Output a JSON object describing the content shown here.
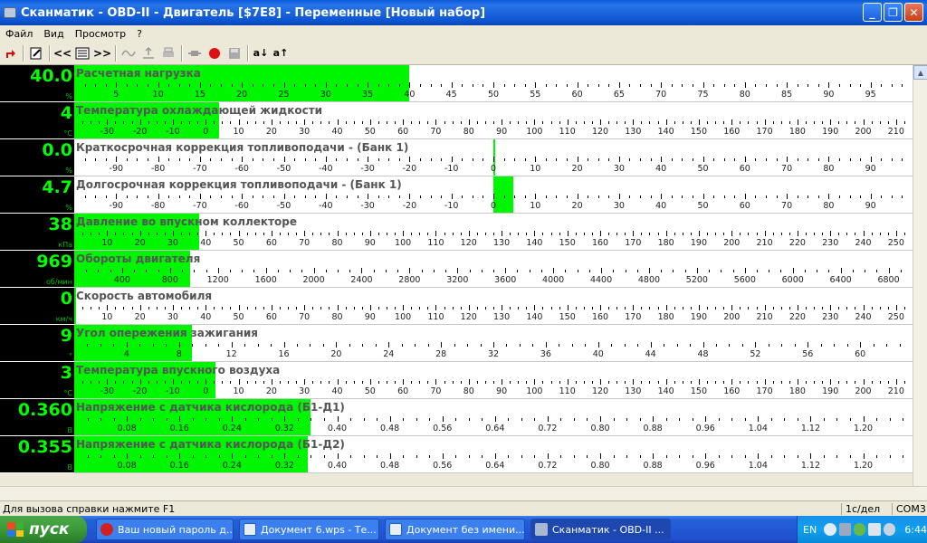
{
  "window": {
    "title": "Сканматик - OBD-II - Двигатель [$7E8] - Переменные [Новый набор]",
    "buttons": [
      "_",
      "❐",
      "✕"
    ]
  },
  "menu": [
    "Файл",
    "Вид",
    "Просмотр",
    "?"
  ],
  "toolbar": {
    "icons": [
      "exit-icon",
      "edit-icon",
      "prev-icon",
      "list-icon",
      "next-icon",
      "wave-icon",
      "upload-icon",
      "print-icon",
      "connector-icon",
      "record-icon",
      "save-icon",
      "sort-asc-icon",
      "sort-desc-icon"
    ],
    "glyphs": {
      "prev": "<<",
      "next": ">>",
      "sort_asc": "a↓",
      "sort_desc": "a↑"
    }
  },
  "parameters": [
    {
      "title": "Расчетная нагрузка",
      "value": "40.0",
      "unit": "%",
      "bar": [
        0,
        40
      ],
      "axis": {
        "min": 0,
        "max": 100,
        "major": 5,
        "labels": [
          "5",
          "10",
          "15",
          "20",
          "25",
          "30",
          "35",
          "40",
          "45",
          "50",
          "55",
          "60",
          "65",
          "70",
          "75",
          "80",
          "85",
          "90",
          "95"
        ]
      }
    },
    {
      "title": "Температура охлаждающей жидкости",
      "value": "4",
      "unit": "°C",
      "bar": [
        -40,
        4
      ],
      "axis": {
        "min": -40,
        "max": 215,
        "major": 10,
        "labels": [
          "-30",
          "-20",
          "-10",
          "0",
          "10",
          "20",
          "30",
          "40",
          "50",
          "60",
          "70",
          "80",
          "90",
          "100",
          "110",
          "120",
          "130",
          "140",
          "150",
          "160",
          "170",
          "180",
          "190",
          "200",
          "210"
        ]
      }
    },
    {
      "title": "Краткосрочная коррекция топливоподачи - (Банк 1)",
      "value": "0.0",
      "unit": "%",
      "bar": [
        0,
        0
      ],
      "axis": {
        "min": -100,
        "max": 100,
        "major": 10,
        "labels": [
          "-90",
          "-80",
          "-70",
          "-60",
          "-50",
          "-40",
          "-30",
          "-20",
          "-10",
          "0",
          "10",
          "20",
          "30",
          "40",
          "50",
          "60",
          "70",
          "80",
          "90"
        ]
      }
    },
    {
      "title": "Долгосрочная коррекция топливоподачи -  (Банк 1)",
      "value": "4.7",
      "unit": "%",
      "bar": [
        0,
        4.7
      ],
      "axis": {
        "min": -100,
        "max": 100,
        "major": 10,
        "labels": [
          "-90",
          "-80",
          "-70",
          "-60",
          "-50",
          "-40",
          "-30",
          "-20",
          "-10",
          "0",
          "10",
          "20",
          "30",
          "40",
          "50",
          "60",
          "70",
          "80",
          "90"
        ]
      }
    },
    {
      "title": "Давление во впускном коллекторе",
      "value": "38",
      "unit": "кПа",
      "bar": [
        0,
        38
      ],
      "axis": {
        "min": 0,
        "max": 255,
        "major": 10,
        "labels": [
          "10",
          "20",
          "30",
          "40",
          "50",
          "60",
          "70",
          "80",
          "90",
          "100",
          "110",
          "120",
          "130",
          "140",
          "150",
          "160",
          "170",
          "180",
          "190",
          "200",
          "210",
          "220",
          "230",
          "240",
          "250"
        ]
      }
    },
    {
      "title": "Обороты двигателя",
      "value": "969",
      "unit": "об/мин",
      "bar": [
        0,
        969
      ],
      "axis": {
        "min": 0,
        "max": 7000,
        "major": 400,
        "labels": [
          "400",
          "800",
          "1200",
          "1600",
          "2000",
          "2400",
          "2800",
          "3200",
          "3600",
          "4000",
          "4400",
          "4800",
          "5200",
          "5600",
          "6000",
          "6400",
          "6800"
        ]
      }
    },
    {
      "title": "Скорость автомобиля",
      "value": "0",
      "unit": "км/ч",
      "bar": [
        0,
        0
      ],
      "axis": {
        "min": 0,
        "max": 255,
        "major": 10,
        "labels": [
          "10",
          "20",
          "30",
          "40",
          "50",
          "60",
          "70",
          "80",
          "90",
          "100",
          "110",
          "120",
          "130",
          "140",
          "150",
          "160",
          "170",
          "180",
          "190",
          "200",
          "210",
          "220",
          "230",
          "240",
          "250"
        ]
      }
    },
    {
      "title": "Угол опережения зажигания",
      "value": "9",
      "unit": "°",
      "bar": [
        0,
        9
      ],
      "axis": {
        "min": 0,
        "max": 64,
        "major": 4,
        "labels": [
          "4",
          "8",
          "12",
          "16",
          "20",
          "24",
          "28",
          "32",
          "36",
          "40",
          "44",
          "48",
          "52",
          "56",
          "60"
        ]
      }
    },
    {
      "title": "Температура впускного воздуха",
      "value": "3",
      "unit": "°C",
      "bar": [
        -40,
        3
      ],
      "axis": {
        "min": -40,
        "max": 215,
        "major": 10,
        "labels": [
          "-30",
          "-20",
          "-10",
          "0",
          "10",
          "20",
          "30",
          "40",
          "50",
          "60",
          "70",
          "80",
          "90",
          "100",
          "110",
          "120",
          "130",
          "140",
          "150",
          "160",
          "170",
          "180",
          "190",
          "200",
          "210"
        ]
      }
    },
    {
      "title": "Напряжение с датчика кислорода (Б1-Д1)",
      "value": "0.360",
      "unit": "В",
      "bar": [
        0,
        0.36
      ],
      "axis": {
        "min": 0,
        "max": 1.275,
        "major": 0.08,
        "labels": [
          "0.08",
          "0.16",
          "0.24",
          "0.32",
          "0.40",
          "0.48",
          "0.56",
          "0.64",
          "0.72",
          "0.80",
          "0.88",
          "0.96",
          "1.04",
          "1.12",
          "1.20"
        ]
      }
    },
    {
      "title": "Напряжение с датчика кислорода (Б1-Д2)",
      "value": "0.355",
      "unit": "В",
      "bar": [
        0,
        0.355
      ],
      "axis": {
        "min": 0,
        "max": 1.275,
        "major": 0.08,
        "labels": [
          "0.08",
          "0.16",
          "0.24",
          "0.32",
          "0.40",
          "0.48",
          "0.56",
          "0.64",
          "0.72",
          "0.80",
          "0.88",
          "0.96",
          "1.04",
          "1.12",
          "1.20"
        ]
      }
    }
  ],
  "status": {
    "help": "Для вызова справки нажмите F1",
    "rate": "1с/дел",
    "port": "COM3"
  },
  "taskbar": {
    "start": "пуск",
    "tasks": [
      {
        "label": "Ваш новый пароль д...",
        "icon_color": "#d02020",
        "icon": "opera-icon"
      },
      {
        "label": "Документ 6.wps - Те...",
        "icon_color": "#2060c0",
        "icon": "document-icon"
      },
      {
        "label": "Документ без имени...",
        "icon_color": "#2060c0",
        "icon": "document-icon"
      },
      {
        "label": "Сканматик - OBD-II ...",
        "icon_color": "#8090a8",
        "icon": "scanmatik-icon"
      }
    ],
    "lang": "EN",
    "clock": "6:44"
  }
}
